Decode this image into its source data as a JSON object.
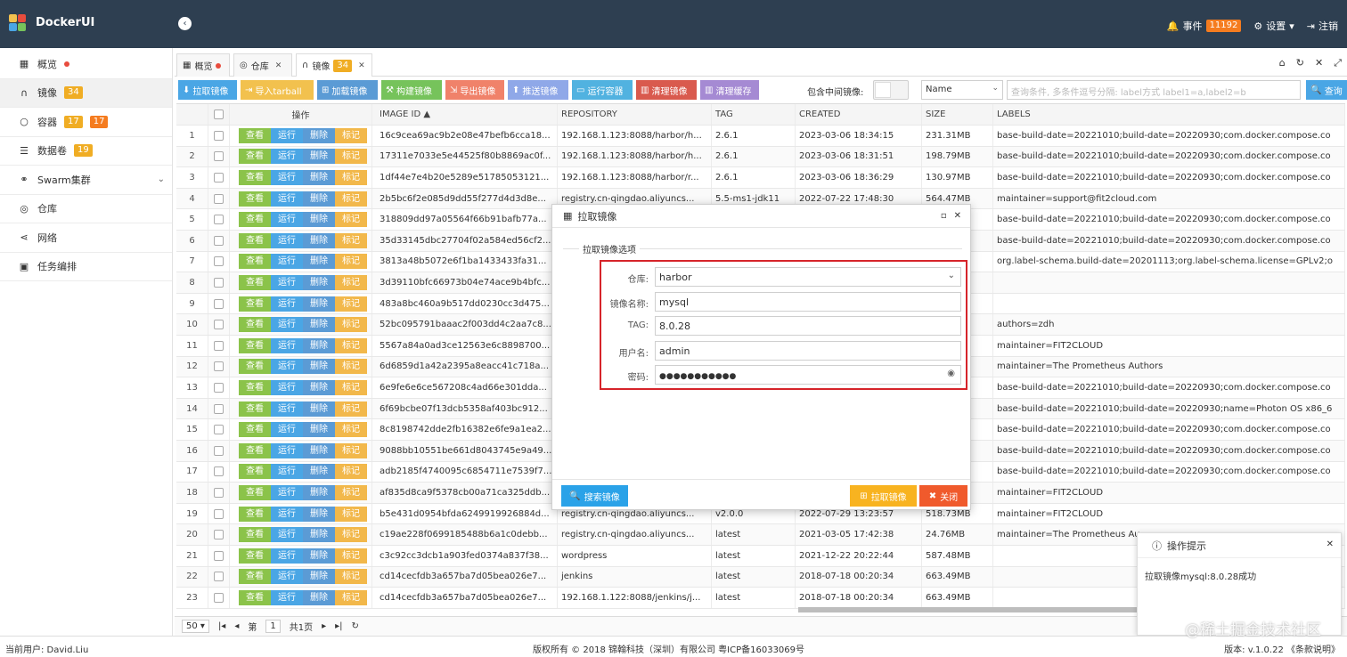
{
  "header": {
    "brand": "DockerUI",
    "events_label": "事件",
    "events_count": "11192",
    "settings_label": "设置",
    "logout_label": "注销"
  },
  "sidebar": {
    "items": [
      {
        "label": "概览",
        "icon": "grid-icon"
      },
      {
        "label": "镜像",
        "icon": "headphones-icon",
        "badge": "34"
      },
      {
        "label": "容器",
        "icon": "circle-icon",
        "badge1": "17",
        "badge2": "17"
      },
      {
        "label": "数据卷",
        "icon": "database-icon",
        "badge": "19"
      },
      {
        "label": "Swarm集群",
        "icon": "sitemap-icon"
      },
      {
        "label": "仓库",
        "icon": "podcast-icon"
      },
      {
        "label": "网络",
        "icon": "share-icon"
      },
      {
        "label": "任务编排",
        "icon": "cubes-icon"
      }
    ]
  },
  "tabs": [
    {
      "label": "概览"
    },
    {
      "label": "仓库"
    },
    {
      "label": "镜像",
      "badge": "34"
    }
  ],
  "toolbar": {
    "buttons": [
      "拉取镜像",
      "导入tarball",
      "加载镜像",
      "构建镜像",
      "导出镜像",
      "推送镜像",
      "运行容器",
      "清理镜像",
      "清理缓存"
    ],
    "include_label": "包含中间镜像:",
    "sort_select": "Name",
    "query_placeholder": "查询条件, 多条件逗号分隔: label方式 label1=a,label2=b",
    "query_button": "查询"
  },
  "table": {
    "headers": [
      "操作",
      "IMAGE ID",
      "REPOSITORY",
      "TAG",
      "CREATED",
      "SIZE",
      "LABELS"
    ],
    "actions": [
      "查看",
      "运行",
      "删除",
      "标记"
    ],
    "rows": [
      {
        "n": "1",
        "id": "16c9cea69ac9b2e08e47befb6cca18...",
        "repo": "192.168.1.123:8088/harbor/h...",
        "tag": "2.6.1",
        "created": "2023-03-06 18:34:15",
        "size": "231.31MB",
        "labels": "base-build-date=20221010;build-date=20220930;com.docker.compose.co"
      },
      {
        "n": "2",
        "id": "17311e7033e5e44525f80b8869ac0f...",
        "repo": "192.168.1.123:8088/harbor/h...",
        "tag": "2.6.1",
        "created": "2023-03-06 18:31:51",
        "size": "198.79MB",
        "labels": "base-build-date=20221010;build-date=20220930;com.docker.compose.co"
      },
      {
        "n": "3",
        "id": "1df44e7e4b20e5289e51785053121...",
        "repo": "192.168.1.123:8088/harbor/r...",
        "tag": "2.6.1",
        "created": "2023-03-06 18:36:29",
        "size": "130.97MB",
        "labels": "base-build-date=20221010;build-date=20220930;com.docker.compose.co"
      },
      {
        "n": "4",
        "id": "2b5bc6f2e085d9dd55f277d4d3d8e...",
        "repo": "registry.cn-qingdao.aliyuncs...",
        "tag": "5.5-ms1-jdk11",
        "created": "2022-07-22 17:48:30",
        "size": "564.47MB",
        "labels": "maintainer=support@fit2cloud.com"
      },
      {
        "n": "5",
        "id": "318809dd97a05564f66b91bafb77a...",
        "repo": "",
        "tag": "",
        "created": "",
        "size": "",
        "labels": "base-build-date=20221010;build-date=20220930;com.docker.compose.co"
      },
      {
        "n": "6",
        "id": "35d33145dbc27704f02a584ed56cf2...",
        "repo": "",
        "tag": "",
        "created": "",
        "size": "",
        "labels": "base-build-date=20221010;build-date=20220930;com.docker.compose.co"
      },
      {
        "n": "7",
        "id": "3813a48b5072e6f1ba1433433fa31...",
        "repo": "",
        "tag": "",
        "created": "",
        "size": "",
        "labels": "org.label-schema.build-date=20201113;org.label-schema.license=GPLv2;o"
      },
      {
        "n": "8",
        "id": "3d39110bfc66973b04e74ace9b4bfc...",
        "repo": "",
        "tag": "",
        "created": "",
        "size": "",
        "labels": ""
      },
      {
        "n": "9",
        "id": "483a8bc460a9b517dd0230cc3d475...",
        "repo": "",
        "tag": "",
        "created": "",
        "size": "",
        "labels": ""
      },
      {
        "n": "10",
        "id": "52bc095791baaac2f003dd4c2aa7c8...",
        "repo": "",
        "tag": "",
        "created": "",
        "size": "",
        "labels": "authors=zdh"
      },
      {
        "n": "11",
        "id": "5567a84a0ad3ce12563e6c8898700...",
        "repo": "",
        "tag": "",
        "created": "",
        "size": "",
        "labels": "maintainer=FIT2CLOUD"
      },
      {
        "n": "12",
        "id": "6d6859d1a42a2395a8eacc41c718a...",
        "repo": "",
        "tag": "",
        "created": "",
        "size": "",
        "labels": "maintainer=The Prometheus Authors"
      },
      {
        "n": "13",
        "id": "6e9fe6e6ce567208c4ad66e301dda...",
        "repo": "",
        "tag": "",
        "created": "",
        "size": "",
        "labels": "base-build-date=20221010;build-date=20220930;com.docker.compose.co"
      },
      {
        "n": "14",
        "id": "6f69bcbe07f13dcb5358af403bc912...",
        "repo": "",
        "tag": "",
        "created": "",
        "size": "",
        "labels": "base-build-date=20221010;build-date=20220930;name=Photon OS x86_6"
      },
      {
        "n": "15",
        "id": "8c8198742dde2fb16382e6fe9a1ea2...",
        "repo": "",
        "tag": "",
        "created": "",
        "size": "",
        "labels": "base-build-date=20221010;build-date=20220930;com.docker.compose.co"
      },
      {
        "n": "16",
        "id": "9088bb10551be661d8043745e9a49...",
        "repo": "",
        "tag": "",
        "created": "",
        "size": "",
        "labels": "base-build-date=20221010;build-date=20220930;com.docker.compose.co"
      },
      {
        "n": "17",
        "id": "adb2185f4740095c6854711e7539f7...",
        "repo": "",
        "tag": "",
        "created": "",
        "size": "",
        "labels": "base-build-date=20221010;build-date=20220930;com.docker.compose.co"
      },
      {
        "n": "18",
        "id": "af835d8ca9f5378cb00a71ca325ddb...",
        "repo": "",
        "tag": "",
        "created": "",
        "size": "",
        "labels": "maintainer=FIT2CLOUD"
      },
      {
        "n": "19",
        "id": "b5e431d0954bfda6249919926884d...",
        "repo": "registry.cn-qingdao.aliyuncs...",
        "tag": "v2.0.0",
        "created": "2022-07-29 13:23:57",
        "size": "518.73MB",
        "labels": "maintainer=FIT2CLOUD"
      },
      {
        "n": "20",
        "id": "c19ae228f0699185488b6a1c0debb...",
        "repo": "registry.cn-qingdao.aliyuncs...",
        "tag": "latest",
        "created": "2021-03-05 17:42:38",
        "size": "24.76MB",
        "labels": "maintainer=The Prometheus Au"
      },
      {
        "n": "21",
        "id": "c3c92cc3dcb1a903fed0374a837f38...",
        "repo": "wordpress",
        "tag": "latest",
        "created": "2021-12-22 20:22:44",
        "size": "587.48MB",
        "labels": ""
      },
      {
        "n": "22",
        "id": "cd14cecfdb3a657ba7d05bea026e7...",
        "repo": "jenkins",
        "tag": "latest",
        "created": "2018-07-18 00:20:34",
        "size": "663.49MB",
        "labels": ""
      },
      {
        "n": "23",
        "id": "cd14cecfdb3a657ba7d05bea026e7...",
        "repo": "192.168.1.122:8088/jenkins/j...",
        "tag": "latest",
        "created": "2018-07-18 00:20:34",
        "size": "663.49MB",
        "labels": ""
      }
    ]
  },
  "pager": {
    "page_size": "50",
    "page_prefix": "第",
    "page_value": "1",
    "page_total": "共1页"
  },
  "footer": {
    "user": "当前用户: David.Liu",
    "copyright": "版权所有 © 2018 锦翰科技（深圳）有限公司 粤ICP备16033069号",
    "version": "版本: v.1.0.22 《条款说明》"
  },
  "dialog": {
    "title": "拉取镜像",
    "legend": "拉取镜像选项",
    "fields": [
      {
        "label": "仓库:",
        "value": "harbor"
      },
      {
        "label": "镜像名称:",
        "value": "mysql"
      },
      {
        "label": "TAG:",
        "value": "8.0.28"
      },
      {
        "label": "用户名:",
        "value": "admin"
      },
      {
        "label": "密码:",
        "value": "●●●●●●●●●●●"
      }
    ],
    "search_button": "搜索镜像",
    "pull_button": "拉取镜像",
    "close_button": "关闭"
  },
  "toast": {
    "title": "操作提示",
    "message": "拉取镜像mysql:8.0.28成功"
  },
  "watermark": "@稀土掘金技术社区",
  "colors": {
    "header_bg": "#2e3f51",
    "badge_orange": "#f0ad24",
    "badge_red": "#e84c3d",
    "highlight_red": "#d6242a"
  }
}
